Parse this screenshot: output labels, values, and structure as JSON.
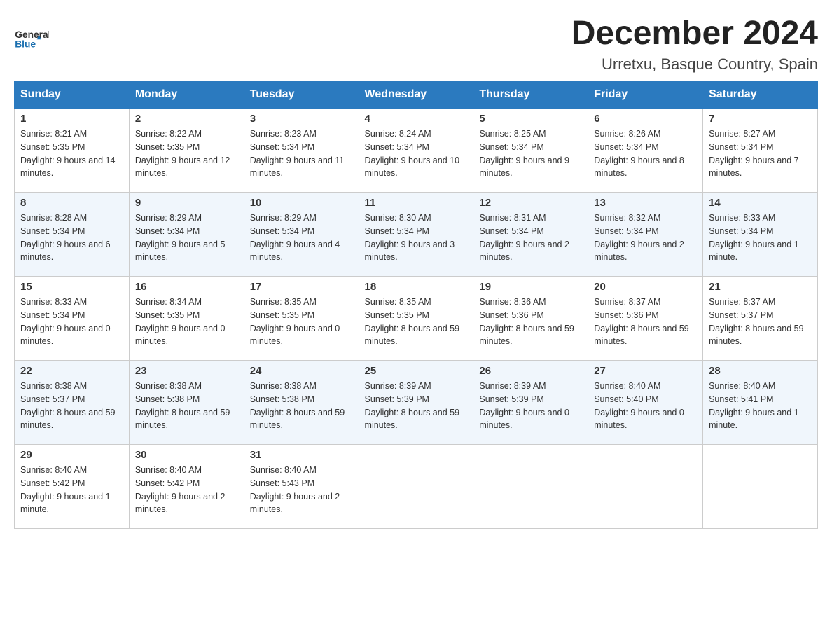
{
  "header": {
    "logo_text_general": "General",
    "logo_text_blue": "Blue",
    "month_title": "December 2024",
    "location": "Urretxu, Basque Country, Spain"
  },
  "days_of_week": [
    "Sunday",
    "Monday",
    "Tuesday",
    "Wednesday",
    "Thursday",
    "Friday",
    "Saturday"
  ],
  "weeks": [
    [
      {
        "day": "1",
        "sunrise": "8:21 AM",
        "sunset": "5:35 PM",
        "daylight": "9 hours and 14 minutes."
      },
      {
        "day": "2",
        "sunrise": "8:22 AM",
        "sunset": "5:35 PM",
        "daylight": "9 hours and 12 minutes."
      },
      {
        "day": "3",
        "sunrise": "8:23 AM",
        "sunset": "5:34 PM",
        "daylight": "9 hours and 11 minutes."
      },
      {
        "day": "4",
        "sunrise": "8:24 AM",
        "sunset": "5:34 PM",
        "daylight": "9 hours and 10 minutes."
      },
      {
        "day": "5",
        "sunrise": "8:25 AM",
        "sunset": "5:34 PM",
        "daylight": "9 hours and 9 minutes."
      },
      {
        "day": "6",
        "sunrise": "8:26 AM",
        "sunset": "5:34 PM",
        "daylight": "9 hours and 8 minutes."
      },
      {
        "day": "7",
        "sunrise": "8:27 AM",
        "sunset": "5:34 PM",
        "daylight": "9 hours and 7 minutes."
      }
    ],
    [
      {
        "day": "8",
        "sunrise": "8:28 AM",
        "sunset": "5:34 PM",
        "daylight": "9 hours and 6 minutes."
      },
      {
        "day": "9",
        "sunrise": "8:29 AM",
        "sunset": "5:34 PM",
        "daylight": "9 hours and 5 minutes."
      },
      {
        "day": "10",
        "sunrise": "8:29 AM",
        "sunset": "5:34 PM",
        "daylight": "9 hours and 4 minutes."
      },
      {
        "day": "11",
        "sunrise": "8:30 AM",
        "sunset": "5:34 PM",
        "daylight": "9 hours and 3 minutes."
      },
      {
        "day": "12",
        "sunrise": "8:31 AM",
        "sunset": "5:34 PM",
        "daylight": "9 hours and 2 minutes."
      },
      {
        "day": "13",
        "sunrise": "8:32 AM",
        "sunset": "5:34 PM",
        "daylight": "9 hours and 2 minutes."
      },
      {
        "day": "14",
        "sunrise": "8:33 AM",
        "sunset": "5:34 PM",
        "daylight": "9 hours and 1 minute."
      }
    ],
    [
      {
        "day": "15",
        "sunrise": "8:33 AM",
        "sunset": "5:34 PM",
        "daylight": "9 hours and 0 minutes."
      },
      {
        "day": "16",
        "sunrise": "8:34 AM",
        "sunset": "5:35 PM",
        "daylight": "9 hours and 0 minutes."
      },
      {
        "day": "17",
        "sunrise": "8:35 AM",
        "sunset": "5:35 PM",
        "daylight": "9 hours and 0 minutes."
      },
      {
        "day": "18",
        "sunrise": "8:35 AM",
        "sunset": "5:35 PM",
        "daylight": "8 hours and 59 minutes."
      },
      {
        "day": "19",
        "sunrise": "8:36 AM",
        "sunset": "5:36 PM",
        "daylight": "8 hours and 59 minutes."
      },
      {
        "day": "20",
        "sunrise": "8:37 AM",
        "sunset": "5:36 PM",
        "daylight": "8 hours and 59 minutes."
      },
      {
        "day": "21",
        "sunrise": "8:37 AM",
        "sunset": "5:37 PM",
        "daylight": "8 hours and 59 minutes."
      }
    ],
    [
      {
        "day": "22",
        "sunrise": "8:38 AM",
        "sunset": "5:37 PM",
        "daylight": "8 hours and 59 minutes."
      },
      {
        "day": "23",
        "sunrise": "8:38 AM",
        "sunset": "5:38 PM",
        "daylight": "8 hours and 59 minutes."
      },
      {
        "day": "24",
        "sunrise": "8:38 AM",
        "sunset": "5:38 PM",
        "daylight": "8 hours and 59 minutes."
      },
      {
        "day": "25",
        "sunrise": "8:39 AM",
        "sunset": "5:39 PM",
        "daylight": "8 hours and 59 minutes."
      },
      {
        "day": "26",
        "sunrise": "8:39 AM",
        "sunset": "5:39 PM",
        "daylight": "9 hours and 0 minutes."
      },
      {
        "day": "27",
        "sunrise": "8:40 AM",
        "sunset": "5:40 PM",
        "daylight": "9 hours and 0 minutes."
      },
      {
        "day": "28",
        "sunrise": "8:40 AM",
        "sunset": "5:41 PM",
        "daylight": "9 hours and 1 minute."
      }
    ],
    [
      {
        "day": "29",
        "sunrise": "8:40 AM",
        "sunset": "5:42 PM",
        "daylight": "9 hours and 1 minute."
      },
      {
        "day": "30",
        "sunrise": "8:40 AM",
        "sunset": "5:42 PM",
        "daylight": "9 hours and 2 minutes."
      },
      {
        "day": "31",
        "sunrise": "8:40 AM",
        "sunset": "5:43 PM",
        "daylight": "9 hours and 2 minutes."
      },
      null,
      null,
      null,
      null
    ]
  ]
}
